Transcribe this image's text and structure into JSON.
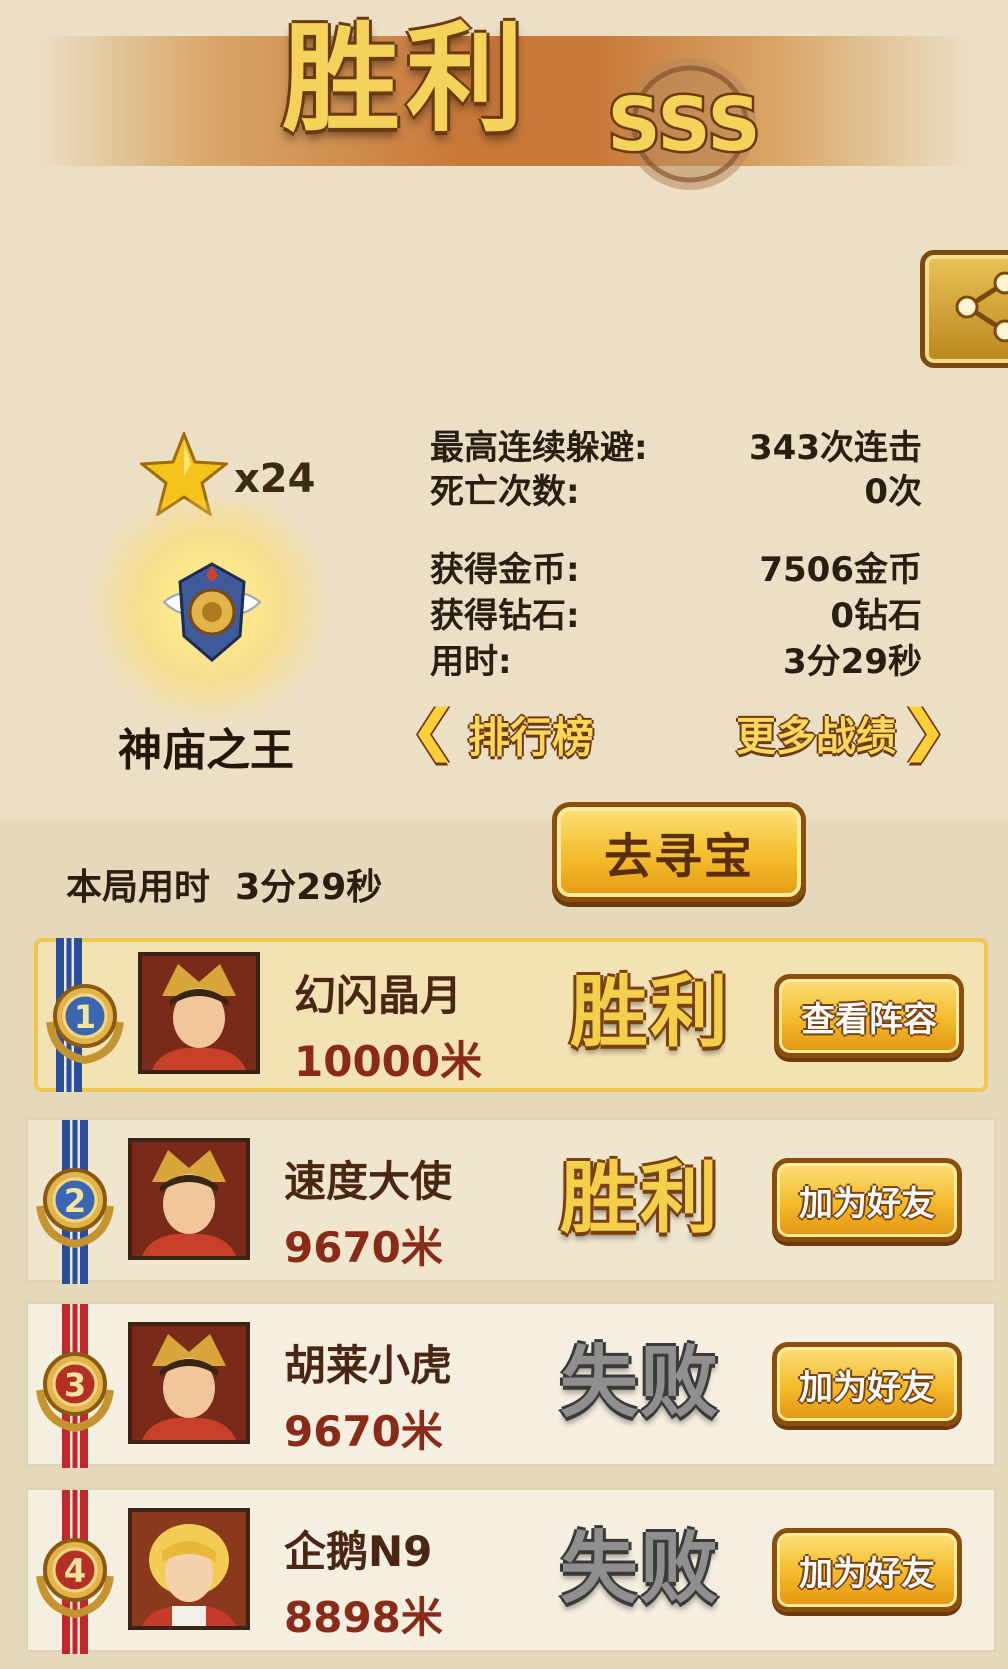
{
  "header": {
    "title": "胜利",
    "rank_grade": "SSS"
  },
  "achievement": {
    "star_count": "x24",
    "title": "神庙之王"
  },
  "stats": {
    "max_dodge_label": "最高连续躲避:",
    "max_dodge_value": "343次连击",
    "deaths_label": "死亡次数:",
    "deaths_value": "0次",
    "coins_label": "获得金币:",
    "coins_value": "7506金币",
    "diamonds_label": "获得钻石:",
    "diamonds_value": "0钻石",
    "time_label": "用时:",
    "time_value": "3分29秒"
  },
  "nav": {
    "leaderboard": "排行榜",
    "more_records": "更多战绩"
  },
  "round": {
    "time_label": "本局用时",
    "time_value": "3分29秒"
  },
  "treasure_button": "去寻宝",
  "players": [
    {
      "rank": "1",
      "name": "幻闪晶月",
      "distance": "10000米",
      "result": "胜利",
      "action": "查看阵容"
    },
    {
      "rank": "2",
      "name": "速度大使",
      "distance": "9670米",
      "result": "胜利",
      "action": "加为好友"
    },
    {
      "rank": "3",
      "name": "胡莱小虎",
      "distance": "9670米",
      "result": "失败",
      "action": "加为好友"
    },
    {
      "rank": "4",
      "name": "企鹅N9",
      "distance": "8898米",
      "result": "失败",
      "action": "加为好友"
    }
  ],
  "colors": {
    "accent_gold": "#f4bd2c",
    "win_text": "#f3cf4c",
    "lose_text": "#8f8f8f",
    "distance_red": "#8a2a18"
  }
}
